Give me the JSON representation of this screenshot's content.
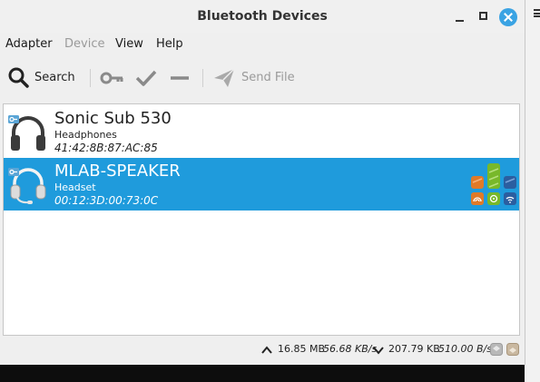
{
  "window": {
    "title": "Bluetooth Devices"
  },
  "menu": {
    "adapter": "Adapter",
    "device": "Device",
    "view": "View",
    "help": "Help"
  },
  "toolbar": {
    "search_label": "Search",
    "send_file_label": "Send File"
  },
  "devices": [
    {
      "name": "Sonic Sub 530",
      "type": "Headphones",
      "address": "41:42:8B:87:AC:85",
      "selected": false,
      "icon": "headphones-icon"
    },
    {
      "name": "MLAB-SPEAKER",
      "type": "Headset",
      "address": "00:12:3D:00:73:0C",
      "selected": true,
      "icon": "headset-icon"
    }
  ],
  "statusbar": {
    "upload_total": "16.85 MB",
    "upload_rate": "56.68 KB/s",
    "download_total": "207.79 KB",
    "download_rate": "510.00 B/s"
  },
  "colors": {
    "selection": "#1f9bdc",
    "close_button": "#3aa3e3"
  }
}
